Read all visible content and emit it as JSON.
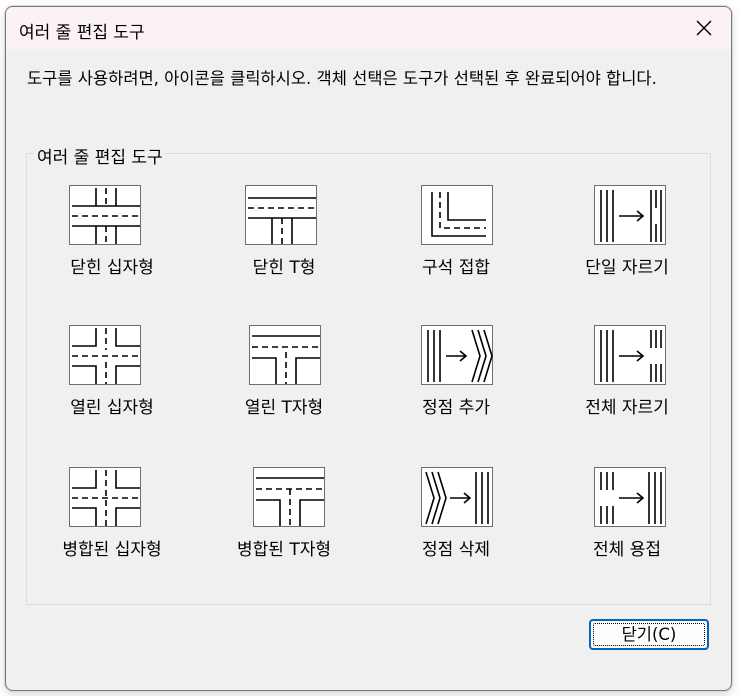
{
  "window": {
    "title": "여러 줄 편집 도구",
    "close_glyph": "✕"
  },
  "instructions": "도구를 사용하려면, 아이콘을 클릭하시오. 객체 선택은 도구가 선택된 후 완료되어야 합니다.",
  "group": {
    "label": "여러 줄 편집 도구",
    "tools": [
      {
        "label": "닫힌 십자형",
        "icon": "closed-cross-icon"
      },
      {
        "label": "닫힌 T형",
        "icon": "closed-tee-icon"
      },
      {
        "label": "구석 접합",
        "icon": "corner-joint-icon"
      },
      {
        "label": "단일 자르기",
        "icon": "cut-single-icon"
      },
      {
        "label": "열린 십자형",
        "icon": "open-cross-icon"
      },
      {
        "label": "열린 T자형",
        "icon": "open-tee-icon"
      },
      {
        "label": "정점 추가",
        "icon": "add-vertex-icon"
      },
      {
        "label": "전체 자르기",
        "icon": "cut-all-icon"
      },
      {
        "label": "병합된 십자형",
        "icon": "merged-cross-icon"
      },
      {
        "label": "병합된 T자형",
        "icon": "merged-tee-icon"
      },
      {
        "label": "정점 삭제",
        "icon": "delete-vertex-icon"
      },
      {
        "label": "전체 용접",
        "icon": "weld-all-icon"
      }
    ]
  },
  "close_button": {
    "label": "닫기(C)"
  },
  "colors": {
    "title_bar": "#fbf3f3",
    "dialog_bg": "#f0f0f0",
    "focus_border": "#0067c0"
  }
}
